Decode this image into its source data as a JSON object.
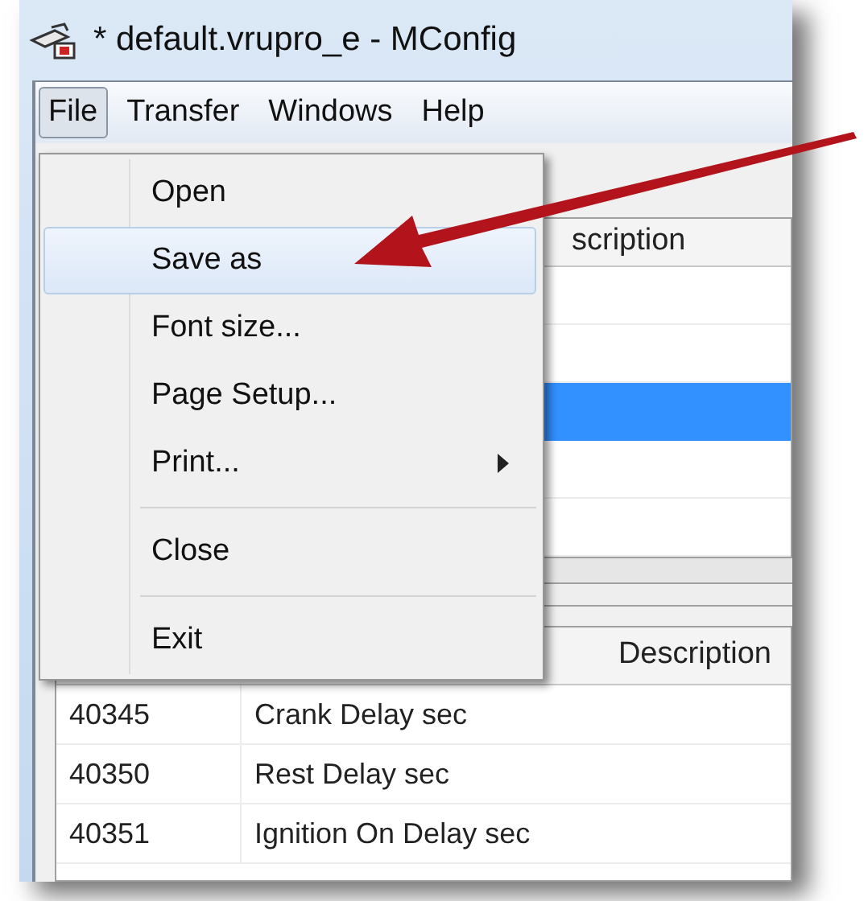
{
  "window": {
    "title": "* default.vrupro_e - MConfig"
  },
  "menu_bar": [
    {
      "label": "File",
      "selected": true
    },
    {
      "label": "Transfer",
      "selected": false
    },
    {
      "label": "Windows",
      "selected": false
    },
    {
      "label": "Help",
      "selected": false
    }
  ],
  "file_menu": [
    {
      "kind": "item",
      "label": "Open",
      "selected": false,
      "submenu": false
    },
    {
      "kind": "item",
      "label": "Save as",
      "selected": true,
      "submenu": false
    },
    {
      "kind": "item",
      "label": "Font size...",
      "selected": false,
      "submenu": false
    },
    {
      "kind": "item",
      "label": "Page Setup...",
      "selected": false,
      "submenu": false
    },
    {
      "kind": "item",
      "label": "Print...",
      "selected": false,
      "submenu": true
    },
    {
      "kind": "separator"
    },
    {
      "kind": "item",
      "label": "Close",
      "selected": false,
      "submenu": false
    },
    {
      "kind": "separator"
    },
    {
      "kind": "item",
      "label": "Exit",
      "selected": false,
      "submenu": false
    }
  ],
  "upper_table": {
    "column_heading": "scription",
    "rows": [
      {
        "selected": false
      },
      {
        "selected": false
      },
      {
        "selected": true
      },
      {
        "selected": false
      },
      {
        "selected": false
      }
    ]
  },
  "lower_table": {
    "column_2_heading": "Description",
    "rows": [
      {
        "column_1": "40345",
        "column_2": "Crank Delay sec"
      },
      {
        "column_1": "40350",
        "column_2": "Rest Delay sec"
      },
      {
        "column_1": "40351",
        "column_2": "Ignition On Delay sec"
      }
    ]
  }
}
